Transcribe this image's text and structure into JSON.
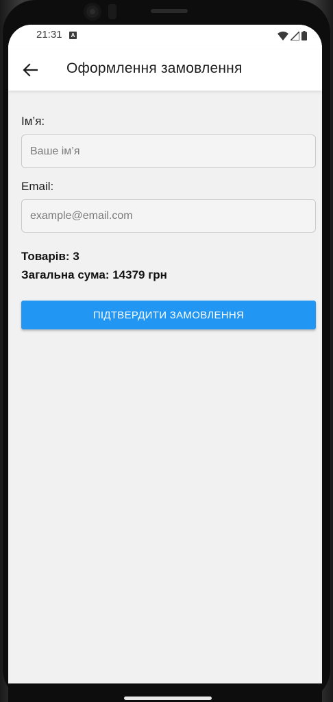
{
  "status_bar": {
    "time": "21:31",
    "notification_icon": "a-letter-icon",
    "notification_letter": "A",
    "icons": [
      "wifi-icon",
      "signal-icon",
      "battery-icon"
    ]
  },
  "app_bar": {
    "back_icon": "arrow-left-icon",
    "title": "Оформлення замовлення"
  },
  "form": {
    "name_label": "Ім’я:",
    "name_placeholder": "Ваше ім’я",
    "name_value": "",
    "email_label": "Email:",
    "email_placeholder": "example@email.com",
    "email_value": ""
  },
  "summary": {
    "items_text": "Товарів: 3",
    "total_text": "Загальна сума: 14379 грн"
  },
  "actions": {
    "confirm_label": "ПІДТВЕРДИТИ ЗАМОВЛЕННЯ"
  },
  "colors": {
    "accent": "#2196f3",
    "background": "#f1f1f1",
    "app_bar": "#ffffff"
  }
}
